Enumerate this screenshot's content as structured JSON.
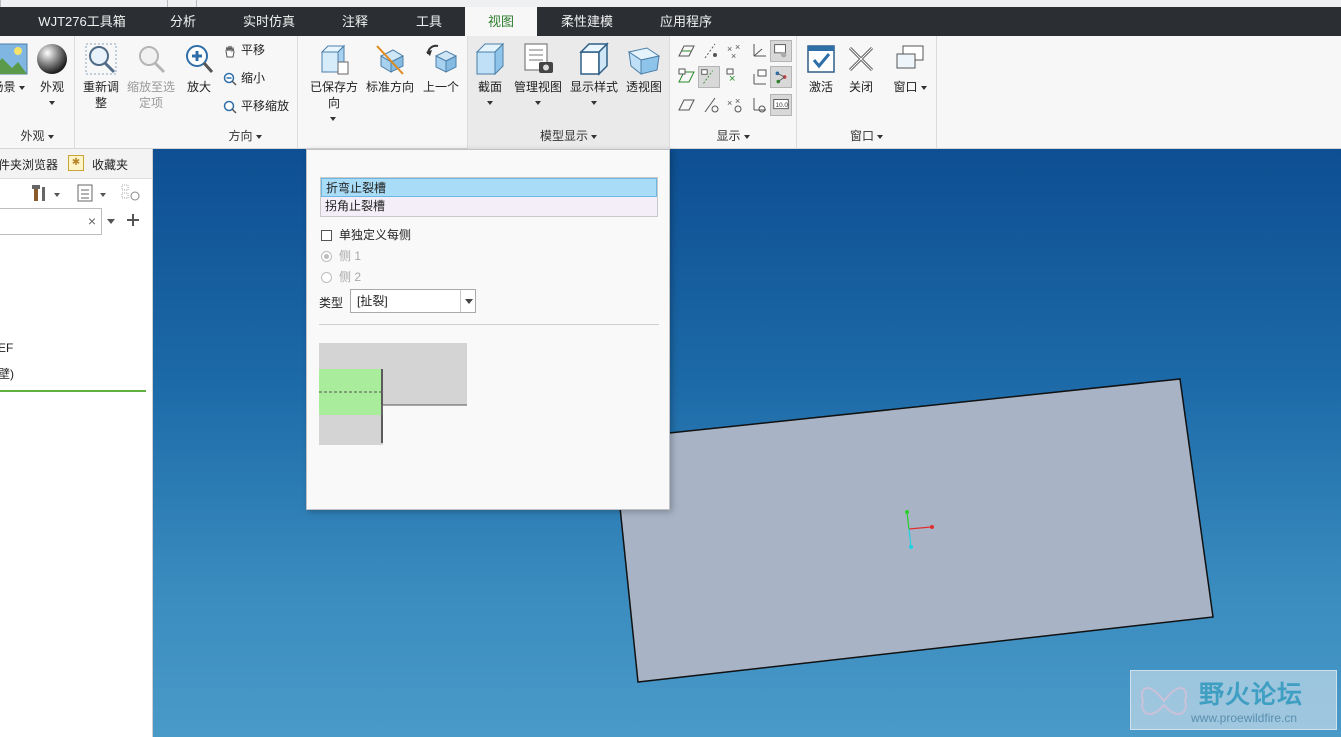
{
  "tabs": [
    "WJT276工具箱",
    "分析",
    "实时仿真",
    "注释",
    "工具",
    "视图",
    "柔性建模",
    "应用程序"
  ],
  "active_tab": "视图",
  "ribbon": {
    "appearance": {
      "scene_label": "场景",
      "appearance_label": "外观",
      "group_label": "外观"
    },
    "orientation": {
      "refit_label": "重新调整",
      "zoom_selected_label": "缩放至选定项",
      "zoom_in_label": "放大",
      "pan_label": "平移",
      "zoom_out_label": "缩小",
      "pan_zoom_label": "平移缩放",
      "group_label": "方向"
    },
    "saved_views": {
      "saved_label": "已保存方向",
      "standard_label": "标准方向",
      "previous_label": "上一个"
    },
    "model_display": {
      "section_label": "截面",
      "manage_views_label": "管理视图",
      "display_style_label": "显示样式",
      "perspective_label": "透视图",
      "group_label": "模型显示"
    },
    "show": {
      "group_label": "显示"
    },
    "window": {
      "activate_label": "激活",
      "close_label": "关闭",
      "window_label": "窗口",
      "group_label": "窗口"
    }
  },
  "left_panel": {
    "tab_folder_browser": "件夹浏览器",
    "tab_favorites": "收藏夹",
    "tree_items": [
      "EF",
      "壁)"
    ]
  },
  "dialog": {
    "list_items": [
      "折弯止裂槽",
      "拐角止裂槽"
    ],
    "selected_index": 0,
    "checkbox_label": "单独定义每侧",
    "checkbox_checked": false,
    "radio_side1": "侧 1",
    "radio_side2": "侧 2",
    "type_label": "类型",
    "type_value": "[扯裂]"
  },
  "watermark": {
    "title": "野火论坛",
    "url": "www.proewildfire.cn"
  },
  "colors": {
    "active_tab_text": "#2d7d2d",
    "model_face": "#a8b4c6",
    "selected_row": "#a9dcf6"
  }
}
